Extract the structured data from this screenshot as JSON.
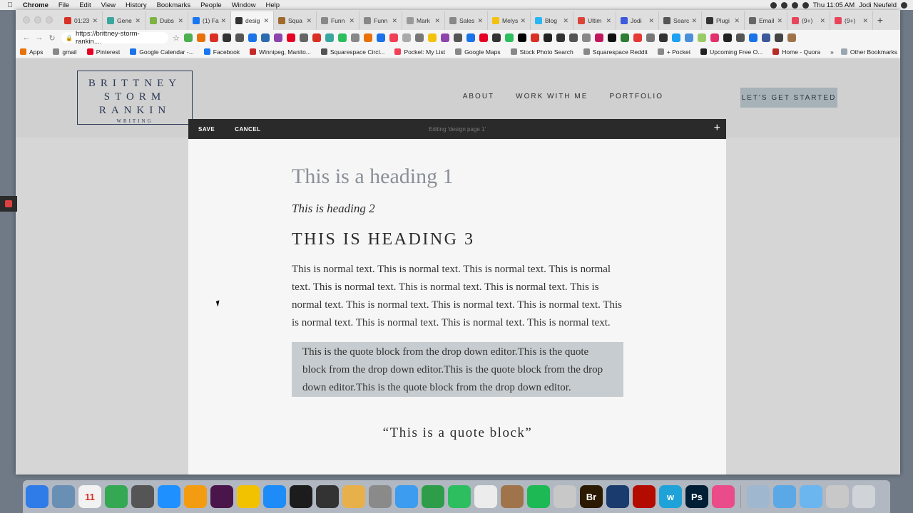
{
  "menubar": {
    "app": "Chrome",
    "items": [
      "File",
      "Edit",
      "View",
      "History",
      "Bookmarks",
      "People",
      "Window",
      "Help"
    ],
    "clock": "Thu 11:05 AM",
    "user": "Jodi Neufeld"
  },
  "tabs": [
    {
      "label": "01:23",
      "color": "#d93025"
    },
    {
      "label": "Gene",
      "color": "#3aa6a0"
    },
    {
      "label": "Dubs",
      "color": "#7cb342"
    },
    {
      "label": "(1) Fa",
      "color": "#1877f2"
    },
    {
      "label": "desig",
      "color": "#333333",
      "active": true
    },
    {
      "label": "Squa",
      "color": "#a06a2c"
    },
    {
      "label": "Funn",
      "color": "#888888"
    },
    {
      "label": "Funn",
      "color": "#888888"
    },
    {
      "label": "Mark",
      "color": "#999999"
    },
    {
      "label": "Sales",
      "color": "#888888"
    },
    {
      "label": "Melys",
      "color": "#f4c20d"
    },
    {
      "label": "Blog",
      "color": "#29b6f6"
    },
    {
      "label": "Ultim",
      "color": "#db4437"
    },
    {
      "label": "Jodi",
      "color": "#3b5bdb"
    },
    {
      "label": "Searc",
      "color": "#555555"
    },
    {
      "label": "Plugi",
      "color": "#333333"
    },
    {
      "label": "Email",
      "color": "#666666"
    },
    {
      "label": "(9+)",
      "color": "#e8455b"
    },
    {
      "label": "(9+)",
      "color": "#e8455b"
    }
  ],
  "address": {
    "url": "https://brittney-storm-rankin...."
  },
  "bookmarks": [
    {
      "label": "Apps",
      "color": "#e8710a"
    },
    {
      "label": "gmail",
      "color": "#888888"
    },
    {
      "label": "Pinterest",
      "color": "#e60023"
    },
    {
      "label": "Google Calendar -...",
      "color": "#1a73e8"
    },
    {
      "label": "Facebook",
      "color": "#1877f2"
    },
    {
      "label": "Winnipeg, Manito...",
      "color": "#c62828"
    },
    {
      "label": "Squarespace Circl...",
      "color": "#555555"
    },
    {
      "label": "Pocket: My List",
      "color": "#ef4056"
    },
    {
      "label": "Google Maps",
      "color": "#888888"
    },
    {
      "label": "Stock Photo Search",
      "color": "#888888"
    },
    {
      "label": "Squarespace Reddit",
      "color": "#888888"
    },
    {
      "label": "+ Pocket",
      "color": "#888888"
    },
    {
      "label": "Upcoming Free O...",
      "color": "#222222"
    },
    {
      "label": "Home - Quora",
      "color": "#b92b27"
    }
  ],
  "bookmarks_more": "»",
  "other_bookmarks": "Other Bookmarks",
  "site": {
    "logo_lines": [
      "BRITTNEY",
      "STORM",
      "RANKIN"
    ],
    "logo_sub": "WRITING",
    "nav": [
      "ABOUT",
      "WORK WITH ME",
      "PORTFOLIO"
    ],
    "cta": "LET'S GET STARTED"
  },
  "editor": {
    "save": "SAVE",
    "cancel": "CANCEL",
    "status": "Editing 'design page 1'",
    "add": "+"
  },
  "content": {
    "heading1": "This is a heading 1",
    "heading2": "This is heading 2",
    "heading3": "THIS IS HEADING 3",
    "paragraph": "This is normal text. This is normal text. This is normal text. This is normal text. This is normal text. This is normal text. This is normal text. This is normal text. This is normal text. This is normal text. This is normal text. This is normal text. This is normal text. This is normal text. This is normal text.",
    "quote_block": "This is the quote block from the drop down editor.This is the quote block from the drop down editor.This is the quote block from the drop down editor.This is the quote block from the drop down editor.",
    "pull_quote": "“This is a quote block”"
  },
  "dock": [
    {
      "name": "finder",
      "color": "#2f7be8"
    },
    {
      "name": "preview",
      "color": "#6a8fb5"
    },
    {
      "name": "calendar",
      "color": "#f2f2f2",
      "text": "11"
    },
    {
      "name": "chrome",
      "color": "#34a853"
    },
    {
      "name": "launchpad",
      "color": "#555555"
    },
    {
      "name": "safari",
      "color": "#1e90ff"
    },
    {
      "name": "photos",
      "color": "#f39c12"
    },
    {
      "name": "slack",
      "color": "#4a154b"
    },
    {
      "name": "app-yellow",
      "color": "#f2c200"
    },
    {
      "name": "app-store",
      "color": "#1d8cf8"
    },
    {
      "name": "quicktime",
      "color": "#1c1c1c"
    },
    {
      "name": "printer",
      "color": "#333333"
    },
    {
      "name": "notes-app",
      "color": "#e8b04a"
    },
    {
      "name": "system-preferences",
      "color": "#8a8a8a"
    },
    {
      "name": "messages",
      "color": "#3b9cf0"
    },
    {
      "name": "kite",
      "color": "#2e9d4a"
    },
    {
      "name": "evernote",
      "color": "#2dbe60"
    },
    {
      "name": "textedit",
      "color": "#ececec"
    },
    {
      "name": "notebook",
      "color": "#a0744a"
    },
    {
      "name": "spotify",
      "color": "#1db954"
    },
    {
      "name": "unknown-app",
      "color": "#c8c8c8"
    },
    {
      "name": "bridge",
      "color": "#2b1a00",
      "text": "Br"
    },
    {
      "name": "1password",
      "color": "#1a3b6e"
    },
    {
      "name": "acrobat",
      "color": "#b30b00"
    },
    {
      "name": "w-app",
      "color": "#1fa2d8",
      "text": "w"
    },
    {
      "name": "photoshop",
      "color": "#001e36",
      "text": "Ps"
    },
    {
      "name": "itunes",
      "color": "#ea4c89"
    },
    {
      "name": "downloads-stack",
      "color": "#9fb7cf"
    },
    {
      "name": "applications-folder",
      "color": "#5aa9e6"
    },
    {
      "name": "documents-folder",
      "color": "#6cb6ef"
    },
    {
      "name": "unknown-stack",
      "color": "#c8c8c8"
    },
    {
      "name": "trash",
      "color": "#d0d4d8"
    }
  ]
}
